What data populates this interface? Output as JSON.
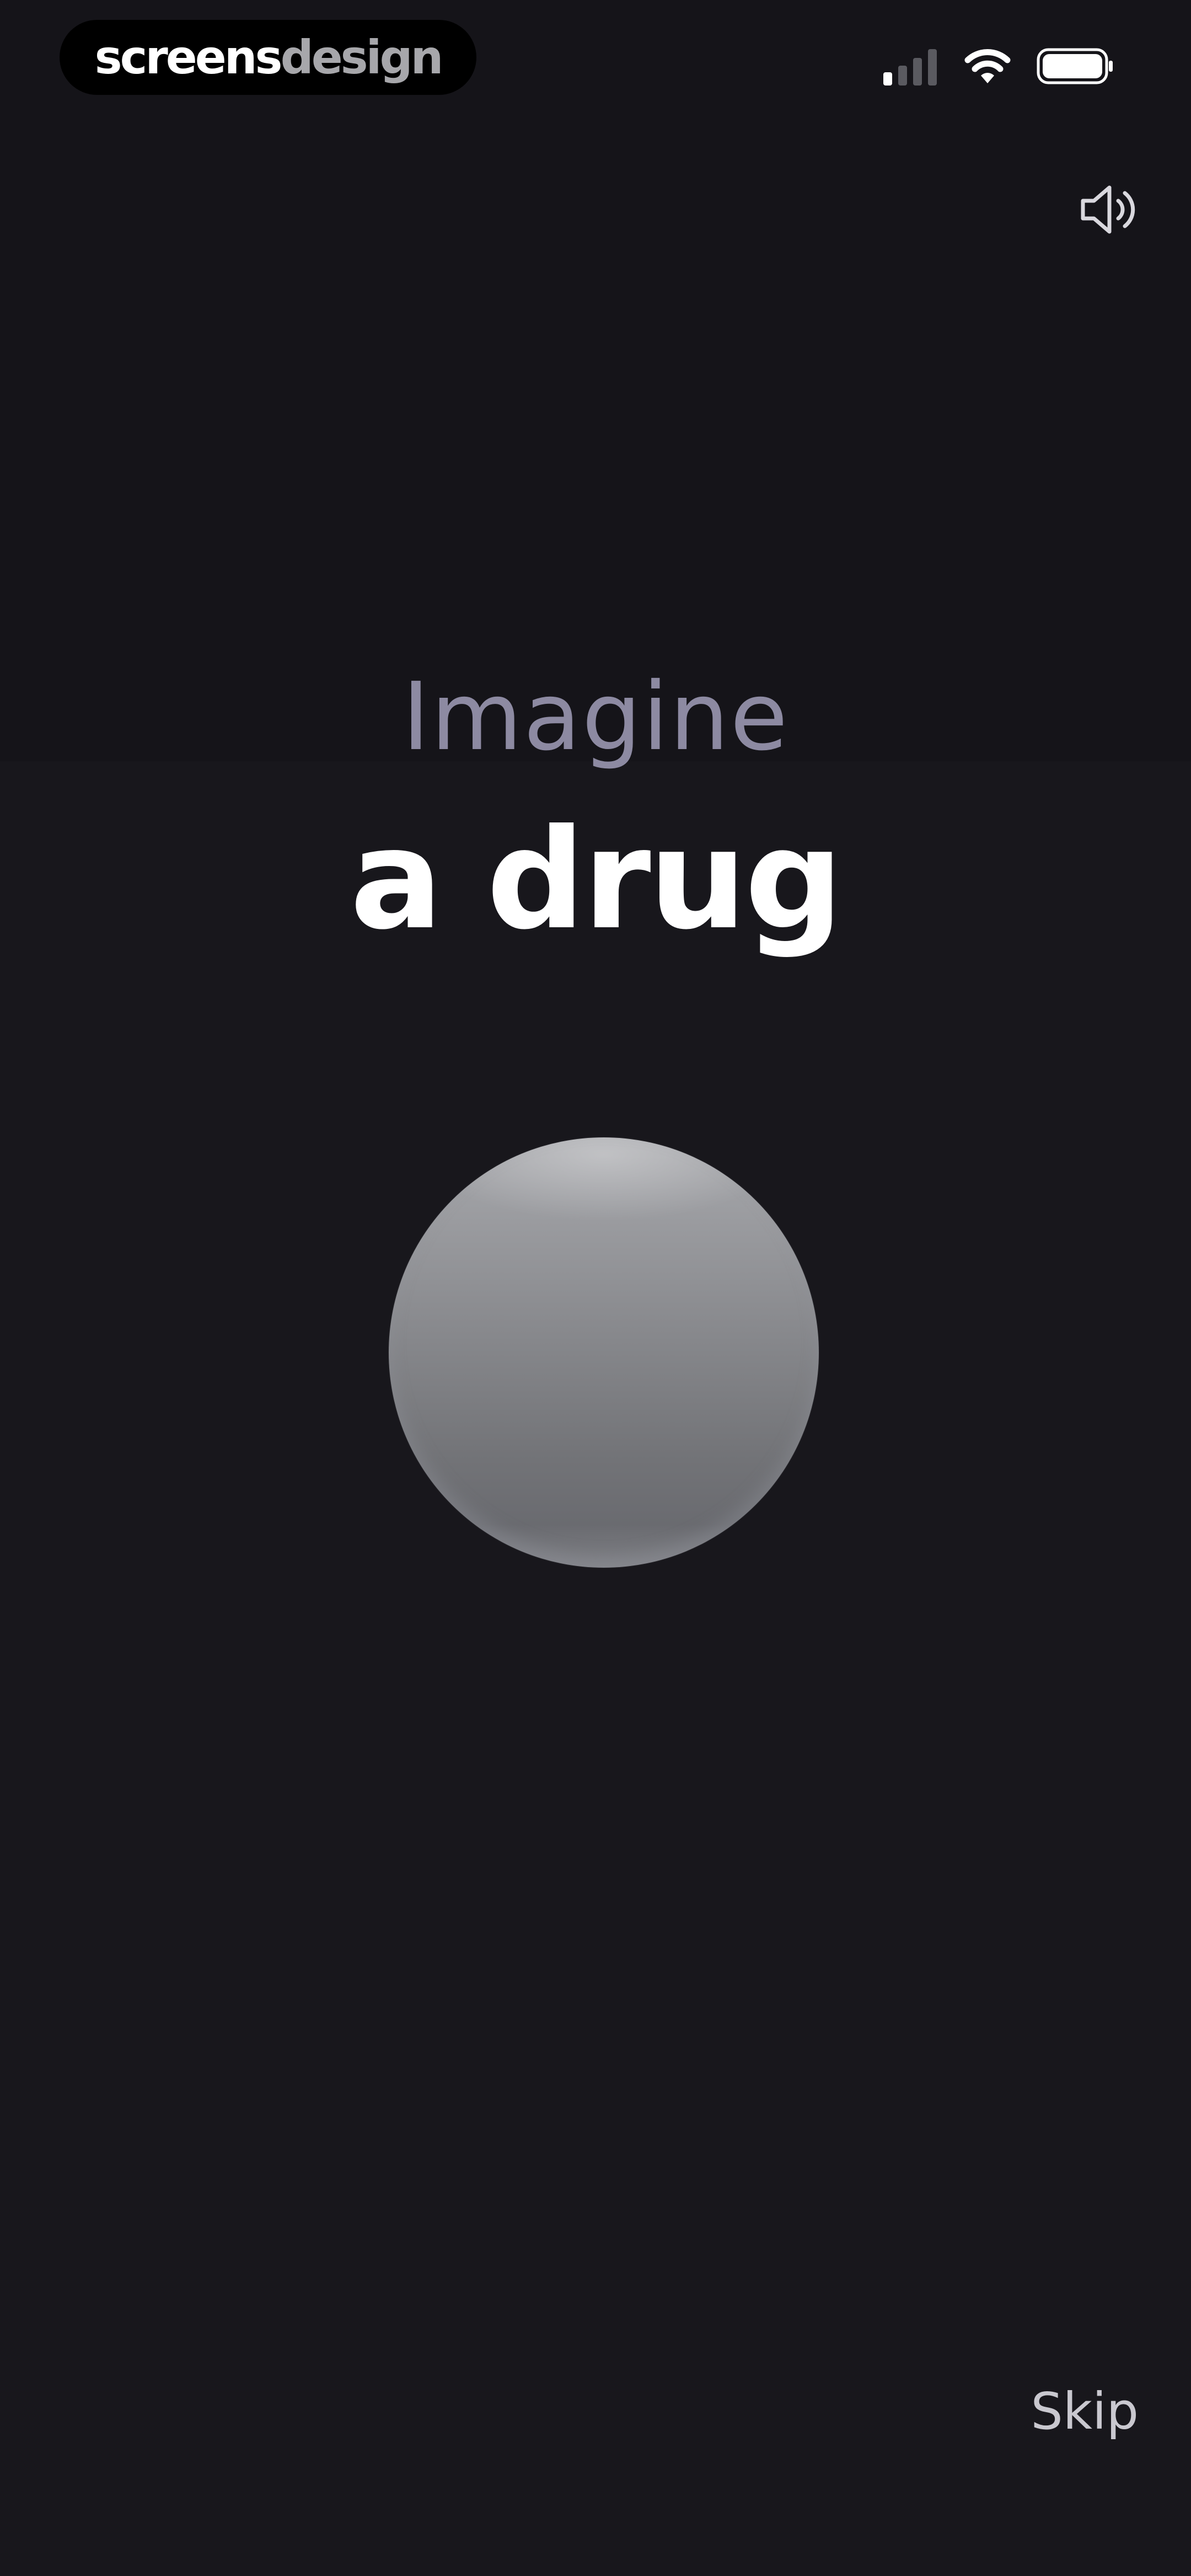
{
  "brand": {
    "part1": "screens",
    "part2": "design"
  },
  "status_bar": {
    "signal_icon": "cellular-signal-icon",
    "wifi_icon": "wifi-icon",
    "battery_icon": "battery-icon"
  },
  "controls": {
    "sound_icon": "speaker-icon",
    "skip_label": "Skip"
  },
  "content": {
    "intro": "Imagine",
    "headline": "a drug"
  },
  "colors": {
    "background": "#18171c",
    "intro_text": "#8d8aa2",
    "headline_text": "#ffffff",
    "skip_text": "#c9c8cf"
  }
}
